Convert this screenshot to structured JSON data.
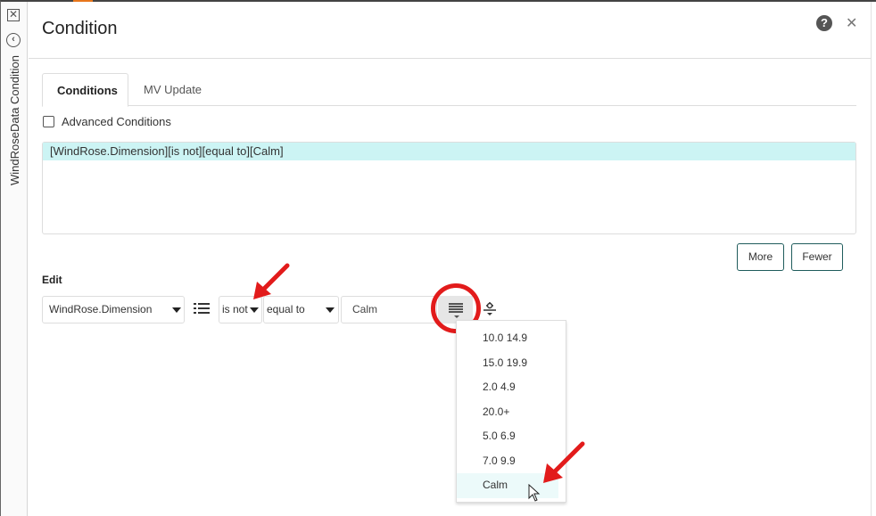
{
  "sidebar": {
    "close_icon": "close-box-icon",
    "back_icon": "back-circle-icon",
    "vertical_label": "WindRoseData Condition"
  },
  "header": {
    "title": "Condition",
    "help_icon": "help-icon",
    "close_icon": "close-icon"
  },
  "tabs": [
    {
      "label": "Conditions",
      "active": true
    },
    {
      "label": "MV Update",
      "active": false
    }
  ],
  "advanced_conditions": {
    "label": "Advanced Conditions",
    "checked": false
  },
  "conditions_list": [
    "[WindRose.Dimension][is not][equal to][Calm]"
  ],
  "buttons": {
    "more": "More",
    "fewer": "Fewer"
  },
  "edit": {
    "label": "Edit",
    "field_select": "WindRose.Dimension",
    "negation_select": "is not",
    "operator_select": "equal to",
    "value_input": "Calm"
  },
  "value_dropdown": {
    "items": [
      "10.0 14.9",
      "15.0 19.9",
      "2.0 4.9",
      "20.0+",
      "5.0 6.9",
      "7.0 9.9",
      "Calm"
    ],
    "hovered": "Calm"
  },
  "annotation_color": "#e21b1b",
  "accent_color": "#1f5c5c",
  "highlight_color": "#ccf4f4"
}
